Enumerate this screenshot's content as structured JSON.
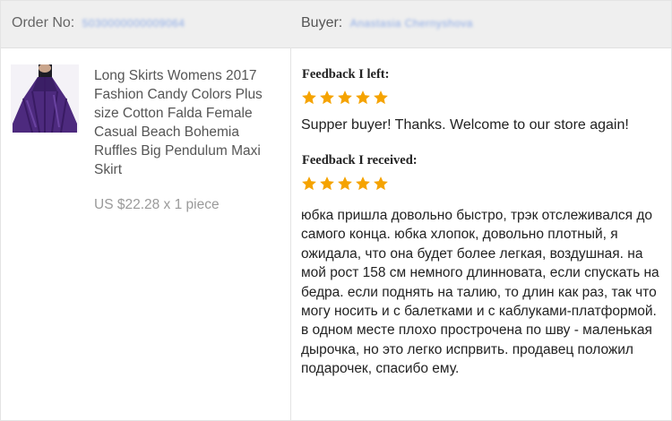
{
  "header": {
    "order_label": "Order No:",
    "order_number": "5030000000009064",
    "buyer_label": "Buyer:",
    "buyer_name": "Anastasia Chernyshova"
  },
  "product": {
    "title": "Long Skirts Womens 2017 Fashion Candy Colors Plus size Cotton Falda Female Casual Beach Bohemia Ruffles Big Pendulum Maxi Skirt",
    "price": "US $22.28 x 1 piece",
    "thumb_icon": "purple-maxi-skirt-photo"
  },
  "feedback_left": {
    "heading": "Feedback I left:",
    "rating": 5,
    "text": "Supper buyer! Thanks. Welcome to our store again!"
  },
  "feedback_received": {
    "heading": "Feedback I received:",
    "rating": 5,
    "text": "юбка пришла довольно быстро, трэк отслеживался до самого конца. юбка хлопок, довольно плотный, я ожидала, что она будет более легкая, воздушная. на мой рост 158 см немного длинновата, если спускать на бедра. если поднять на талию, то длин как раз, так что могу носить и с балетками и с каблуками-платформой. в одном месте плохо прострочена по шву - маленькая дырочка, но это легко испрвить. продавец положил подарочек, спасибо ему."
  },
  "colors": {
    "star": "#f5a300",
    "header_bg": "#efefef"
  }
}
